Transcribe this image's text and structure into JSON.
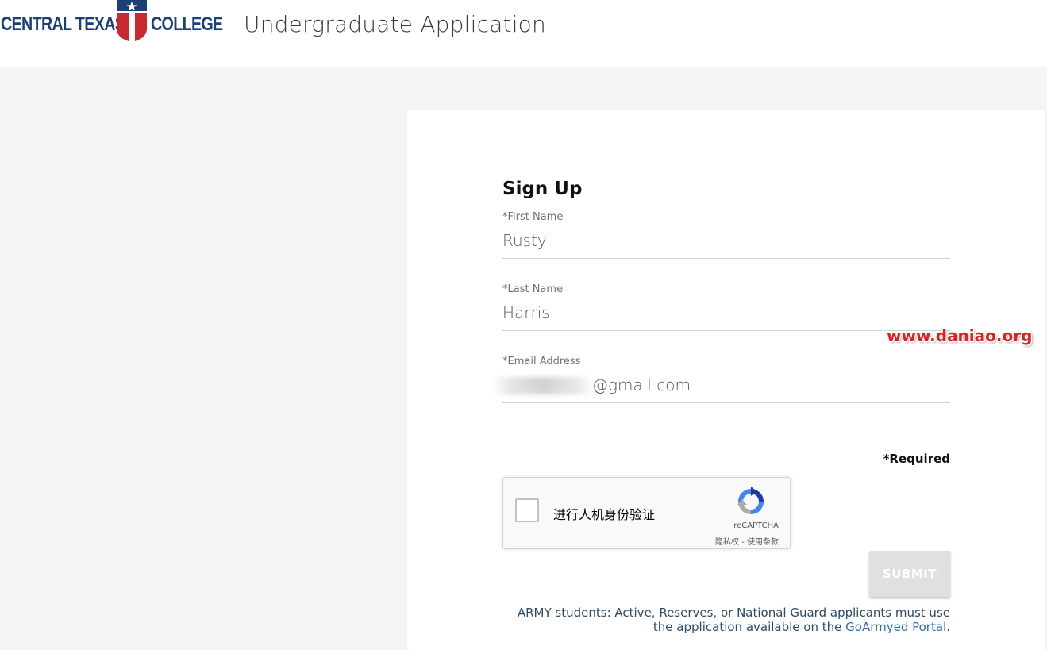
{
  "header": {
    "logo_left": "CENTRAL TEXAS",
    "logo_right": "COLLEGE",
    "logo_reg": "®",
    "title": "Undergraduate Application"
  },
  "form": {
    "title": "Sign Up",
    "fields": [
      {
        "label": "*First Name",
        "value": "Rusty"
      },
      {
        "label": "*Last Name",
        "value": "Harris"
      },
      {
        "label": "*Email Address",
        "value": "@gmail.com"
      }
    ],
    "watermark": "www.daniao.org",
    "required_note": "*Required",
    "recaptcha": {
      "label": "进行人机身份验证",
      "brand": "reCAPTCHA",
      "links": "隐私权 - 使用条款"
    },
    "submit_label": "SUBMIT",
    "army_note_line1": "ARMY students: Active, Reserves, or National Guard applicants must use",
    "army_note_line2_prefix": "the application available on the ",
    "army_link": "GoArmyed Portal",
    "army_note_suffix": "."
  },
  "colors": {
    "logo_blue": "#1c3f78",
    "logo_red": "#c8282e",
    "page_bg": "#f5f5f5",
    "card_bg": "#ffffff",
    "link": "#2f6db5",
    "watermark": "#e02020",
    "submit_disabled": "#e0e0e0"
  }
}
